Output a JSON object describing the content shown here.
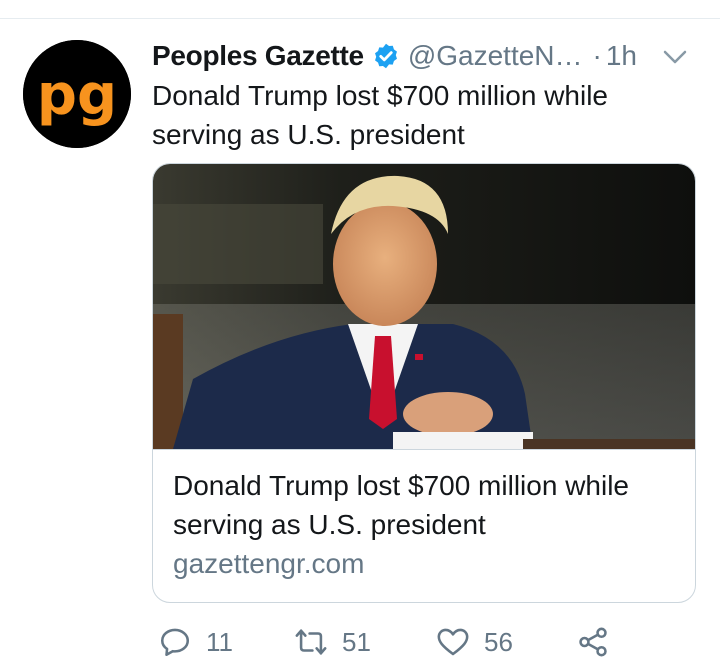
{
  "tweet": {
    "author_name": "Peoples Gazette",
    "author_handle": "@GazetteN…",
    "separator": "·",
    "time": "1h",
    "avatar_text": "pg",
    "text": "Donald Trump lost $700 million while serving as U.S. president",
    "card": {
      "title": "Donald Trump lost $700 million while serving as U.S. president",
      "domain": "gazettengr.com",
      "image_icon": "photo-of-man-in-suit"
    },
    "actions": {
      "replies": "11",
      "retweets": "51",
      "likes": "56"
    },
    "icons": [
      "verified-badge-icon",
      "chevron-down-icon",
      "reply-icon",
      "retweet-icon",
      "like-icon",
      "share-icon"
    ]
  },
  "colors": {
    "brand_orange": "#f7931e",
    "avatar_bg": "#000000",
    "verified_blue": "#1da1f2",
    "secondary_text": "#657786",
    "tie_red": "#c8102e",
    "suit_navy": "#1c2a4a"
  }
}
